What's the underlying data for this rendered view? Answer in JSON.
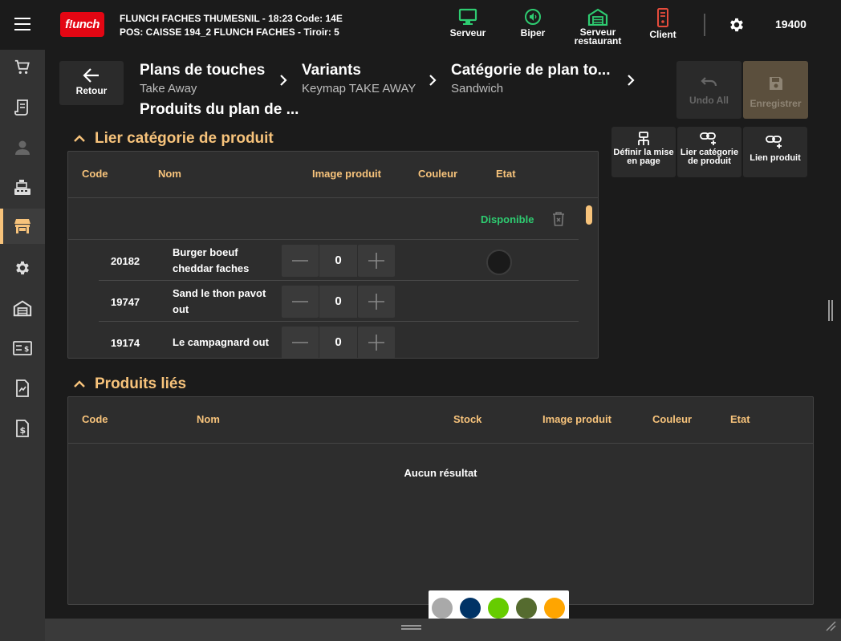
{
  "header": {
    "logo_text": "f!unch",
    "store_line1": "FLUNCH FACHES THUMESNIL - 18:23  Code: 14E",
    "store_line2": "POS: CAISSE 194_2 FLUNCH FACHES - Tiroir: 5",
    "actions": [
      {
        "label": "Serveur",
        "icon": "monitor-icon",
        "color": "#2ecc71"
      },
      {
        "label": "Biper",
        "icon": "pager-icon",
        "color": "#2ecc71"
      },
      {
        "label": "Serveur restaurant",
        "icon": "warehouse-icon",
        "color": "#2ecc71"
      },
      {
        "label": "Client",
        "icon": "client-display-icon",
        "color": "#e74c3c"
      }
    ],
    "user_code": "19400"
  },
  "sidebar": {
    "items": [
      {
        "icon": "cart-icon"
      },
      {
        "icon": "receipt-icon"
      },
      {
        "icon": "user-icon"
      },
      {
        "icon": "cash-register-icon"
      },
      {
        "icon": "store-icon",
        "active": true
      },
      {
        "icon": "gear-icon"
      },
      {
        "icon": "warehouse-icon"
      },
      {
        "icon": "payment-card-icon"
      },
      {
        "icon": "report-icon"
      },
      {
        "icon": "invoice-icon"
      }
    ]
  },
  "breadcrumbs": {
    "back_label": "Retour",
    "items": [
      {
        "title": "Plans de touches",
        "subtitle": "Take Away"
      },
      {
        "title": "Variants",
        "subtitle": "Keymap TAKE AWAY"
      },
      {
        "title": "Catégorie de plan to...",
        "subtitle": "Sandwich"
      }
    ],
    "second_line_title": "Produits du plan de ..."
  },
  "toolbar": {
    "undo_label": "Undo All",
    "save_label": "Enregistrer",
    "define_layout_label": "Définir la mise en page",
    "link_category_label": "Lier catégorie de produit",
    "link_product_label": "Lien produit"
  },
  "link_category_section": {
    "title": "Lier catégorie de produit",
    "columns": [
      "Code",
      "Nom",
      "Image produit",
      "Couleur",
      "Etat"
    ],
    "group_status": "Disponible",
    "rows": [
      {
        "code": "20182",
        "name": "Burger boeuf cheddar faches",
        "qty": "0",
        "color": "#1a1a1a"
      },
      {
        "code": "19747",
        "name": "Sand le thon pavot out",
        "qty": "0"
      },
      {
        "code": "19174",
        "name": "Le campagnard out",
        "qty": "0"
      }
    ]
  },
  "linked_products_section": {
    "title": "Produits liés",
    "columns": [
      "Code",
      "Nom",
      "Stock",
      "Image produit",
      "Couleur",
      "Etat"
    ],
    "empty_message": "Aucun résultat"
  },
  "color_picker": {
    "swatches": [
      "#a9a9a9",
      "#003366",
      "#66cc00",
      "#556b2f",
      "#ffa500"
    ]
  }
}
